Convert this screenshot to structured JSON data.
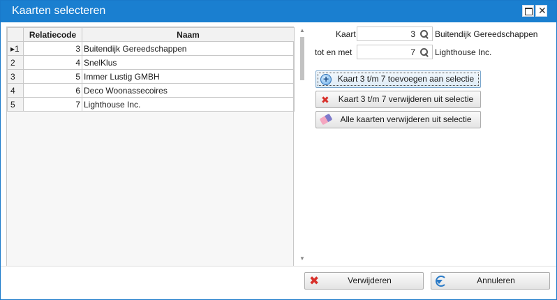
{
  "window": {
    "title": "Kaarten selecteren",
    "maximize_icon": "maximize-icon",
    "close_icon": "close-icon",
    "close_glyph": "✕"
  },
  "grid": {
    "columns": [
      "",
      "Relatiecode",
      "Naam"
    ],
    "rows": [
      {
        "indicator": "▸1",
        "code": "3",
        "name": "Buitendijk Gereedschappen"
      },
      {
        "indicator": "2",
        "code": "4",
        "name": "SnelKlus"
      },
      {
        "indicator": "3",
        "code": "5",
        "name": "Immer Lustig GMBH"
      },
      {
        "indicator": "4",
        "code": "6",
        "name": "Deco Woonassecoires"
      },
      {
        "indicator": "5",
        "code": "7",
        "name": "Lighthouse Inc."
      }
    ]
  },
  "scroll": {
    "up": "▲",
    "down": "▼"
  },
  "form": {
    "kaart_label": "Kaart",
    "kaart_value": "3",
    "kaart_name": "Buitendijk Gereedschappen",
    "totmet_label": "tot en met",
    "totmet_value": "7",
    "totmet_name": "Lighthouse Inc."
  },
  "actions": {
    "add_label": "Kaart 3 t/m 7 toevoegen aan selectie",
    "remove_label": "Kaart 3 t/m 7 verwijderen uit selectie",
    "clear_label": "Alle kaarten verwijderen uit selectie"
  },
  "footer": {
    "delete_label": "Verwijderen",
    "cancel_label": "Annuleren"
  },
  "icons": {
    "search": "search-icon",
    "add": "add-circle-icon",
    "remove": "remove-x-icon",
    "eraser": "eraser-icon",
    "delete": "delete-x-icon",
    "undo": "undo-icon"
  }
}
